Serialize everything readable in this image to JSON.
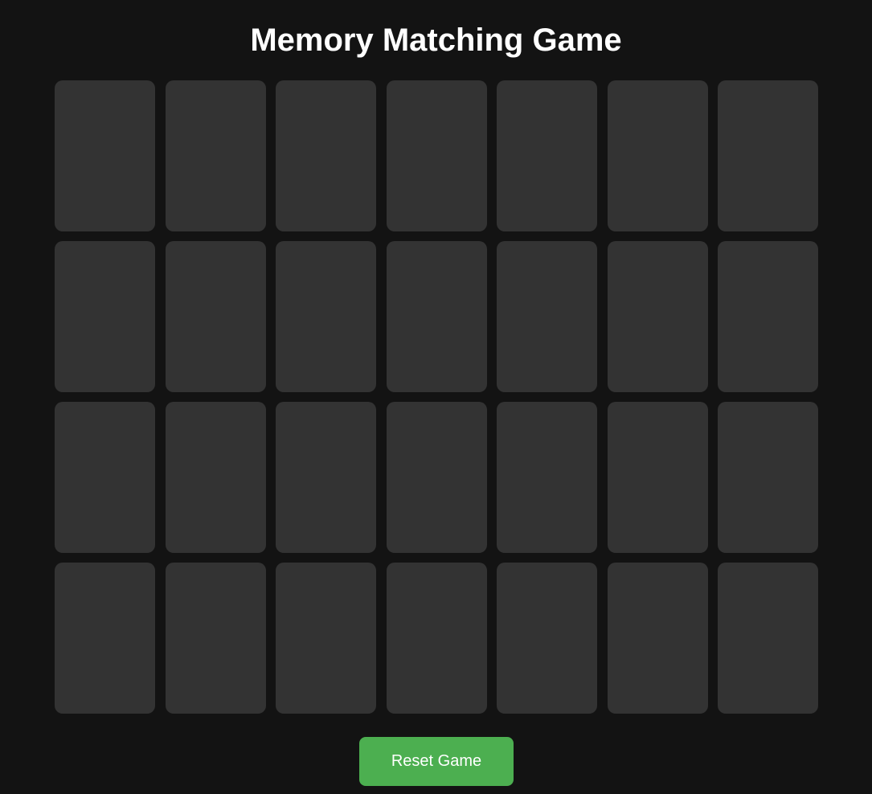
{
  "game": {
    "title": "Memory Matching Game",
    "columns": 7,
    "rows": 4,
    "cards": [
      {
        "state": "face-down"
      },
      {
        "state": "face-down"
      },
      {
        "state": "face-down"
      },
      {
        "state": "face-down"
      },
      {
        "state": "face-down"
      },
      {
        "state": "face-down"
      },
      {
        "state": "face-down"
      },
      {
        "state": "face-down"
      },
      {
        "state": "face-down"
      },
      {
        "state": "face-down"
      },
      {
        "state": "face-down"
      },
      {
        "state": "face-down"
      },
      {
        "state": "face-down"
      },
      {
        "state": "face-down"
      },
      {
        "state": "face-down"
      },
      {
        "state": "face-down"
      },
      {
        "state": "face-down"
      },
      {
        "state": "face-down"
      },
      {
        "state": "face-down"
      },
      {
        "state": "face-down"
      },
      {
        "state": "face-down"
      },
      {
        "state": "face-down"
      },
      {
        "state": "face-down"
      },
      {
        "state": "face-down"
      },
      {
        "state": "face-down"
      },
      {
        "state": "face-down"
      },
      {
        "state": "face-down"
      },
      {
        "state": "face-down"
      }
    ],
    "reset_label": "Reset Game"
  },
  "colors": {
    "background": "#131313",
    "card_back": "#333333",
    "accent": "#4caf50",
    "text": "#ffffff"
  }
}
